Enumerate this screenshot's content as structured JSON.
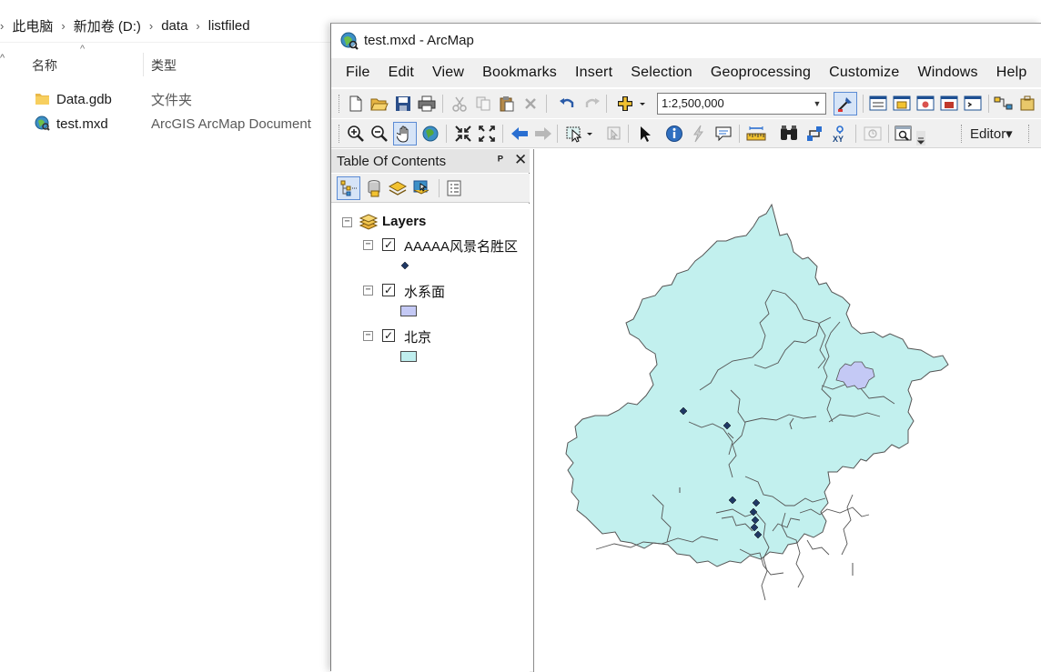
{
  "explorer": {
    "breadcrumb": [
      "此电脑",
      "新加卷 (D:)",
      "data",
      "listfiled"
    ],
    "columns": {
      "name": "名称",
      "type": "类型"
    },
    "files": [
      {
        "name": "Data.gdb",
        "type": "文件夹",
        "icon": "folder-icon"
      },
      {
        "name": "test.mxd",
        "type": "ArcGIS ArcMap Document",
        "icon": "arcmap-document-icon"
      }
    ]
  },
  "arcmap": {
    "title": "test.mxd - ArcMap",
    "menu": [
      "File",
      "Edit",
      "View",
      "Bookmarks",
      "Insert",
      "Selection",
      "Geoprocessing",
      "Customize",
      "Windows",
      "Help"
    ],
    "scale": "1:2,500,000",
    "editor_label": "Editor▾",
    "toc": {
      "title": "Table Of Contents",
      "pin_glyph": "\u0004",
      "close_glyph": "✕",
      "root": "Layers",
      "layers": [
        {
          "name": "AAAAA风景名胜区",
          "checked": true,
          "symbol": "point",
          "color": "#1f3864"
        },
        {
          "name": "水系面",
          "checked": true,
          "symbol": "polygon",
          "color": "#c4c9f5"
        },
        {
          "name": "北京",
          "checked": true,
          "symbol": "polygon",
          "color": "#bfeeee"
        }
      ]
    },
    "colors": {
      "beijing_fill": "#c2f0ee",
      "water_fill": "#c4c9f5",
      "point_fill": "#1f3864",
      "boundary": "#555555"
    }
  }
}
